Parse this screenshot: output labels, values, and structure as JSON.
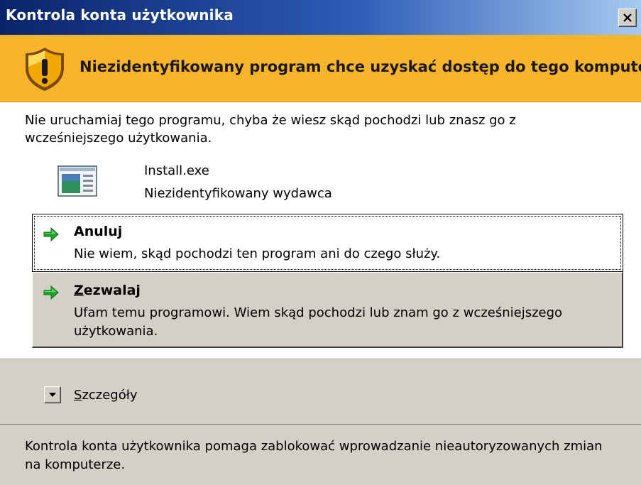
{
  "window": {
    "title": "Kontrola konta użytkownika"
  },
  "banner": {
    "icon": "shield-warning-icon",
    "text": "Niezidentyfikowany program chce uzyskać dostęp do tego komputera",
    "color": "#f9b42a"
  },
  "message": {
    "text": "Nie uruchamiaj tego programu, chyba że wiesz skąd pochodzi lub znasz go z wcześniejszego użytkowania."
  },
  "program": {
    "icon": "application-icon",
    "name": "Install.exe",
    "publisher": "Niezidentyfikowany wydawca"
  },
  "options": {
    "cancel": {
      "icon": "green-arrow-icon",
      "title": "Anuluj",
      "description": "Nie wiem, skąd pochodzi ten program ani do czego służy."
    },
    "allow": {
      "icon": "green-arrow-icon",
      "title_access_key": "Z",
      "title_rest": "ezwalaj",
      "description": "Ufam temu programowi. Wiem skąd pochodzi lub znam go z wcześniejszego użytkowania."
    }
  },
  "details": {
    "icon": "chevron-down-icon",
    "label_access_key": "S",
    "label_rest": "zczegóły"
  },
  "footer": {
    "text": "Kontrola konta użytkownika pomaga zablokować wprowadzanie nieautoryzowanych zmian na komputerze."
  }
}
